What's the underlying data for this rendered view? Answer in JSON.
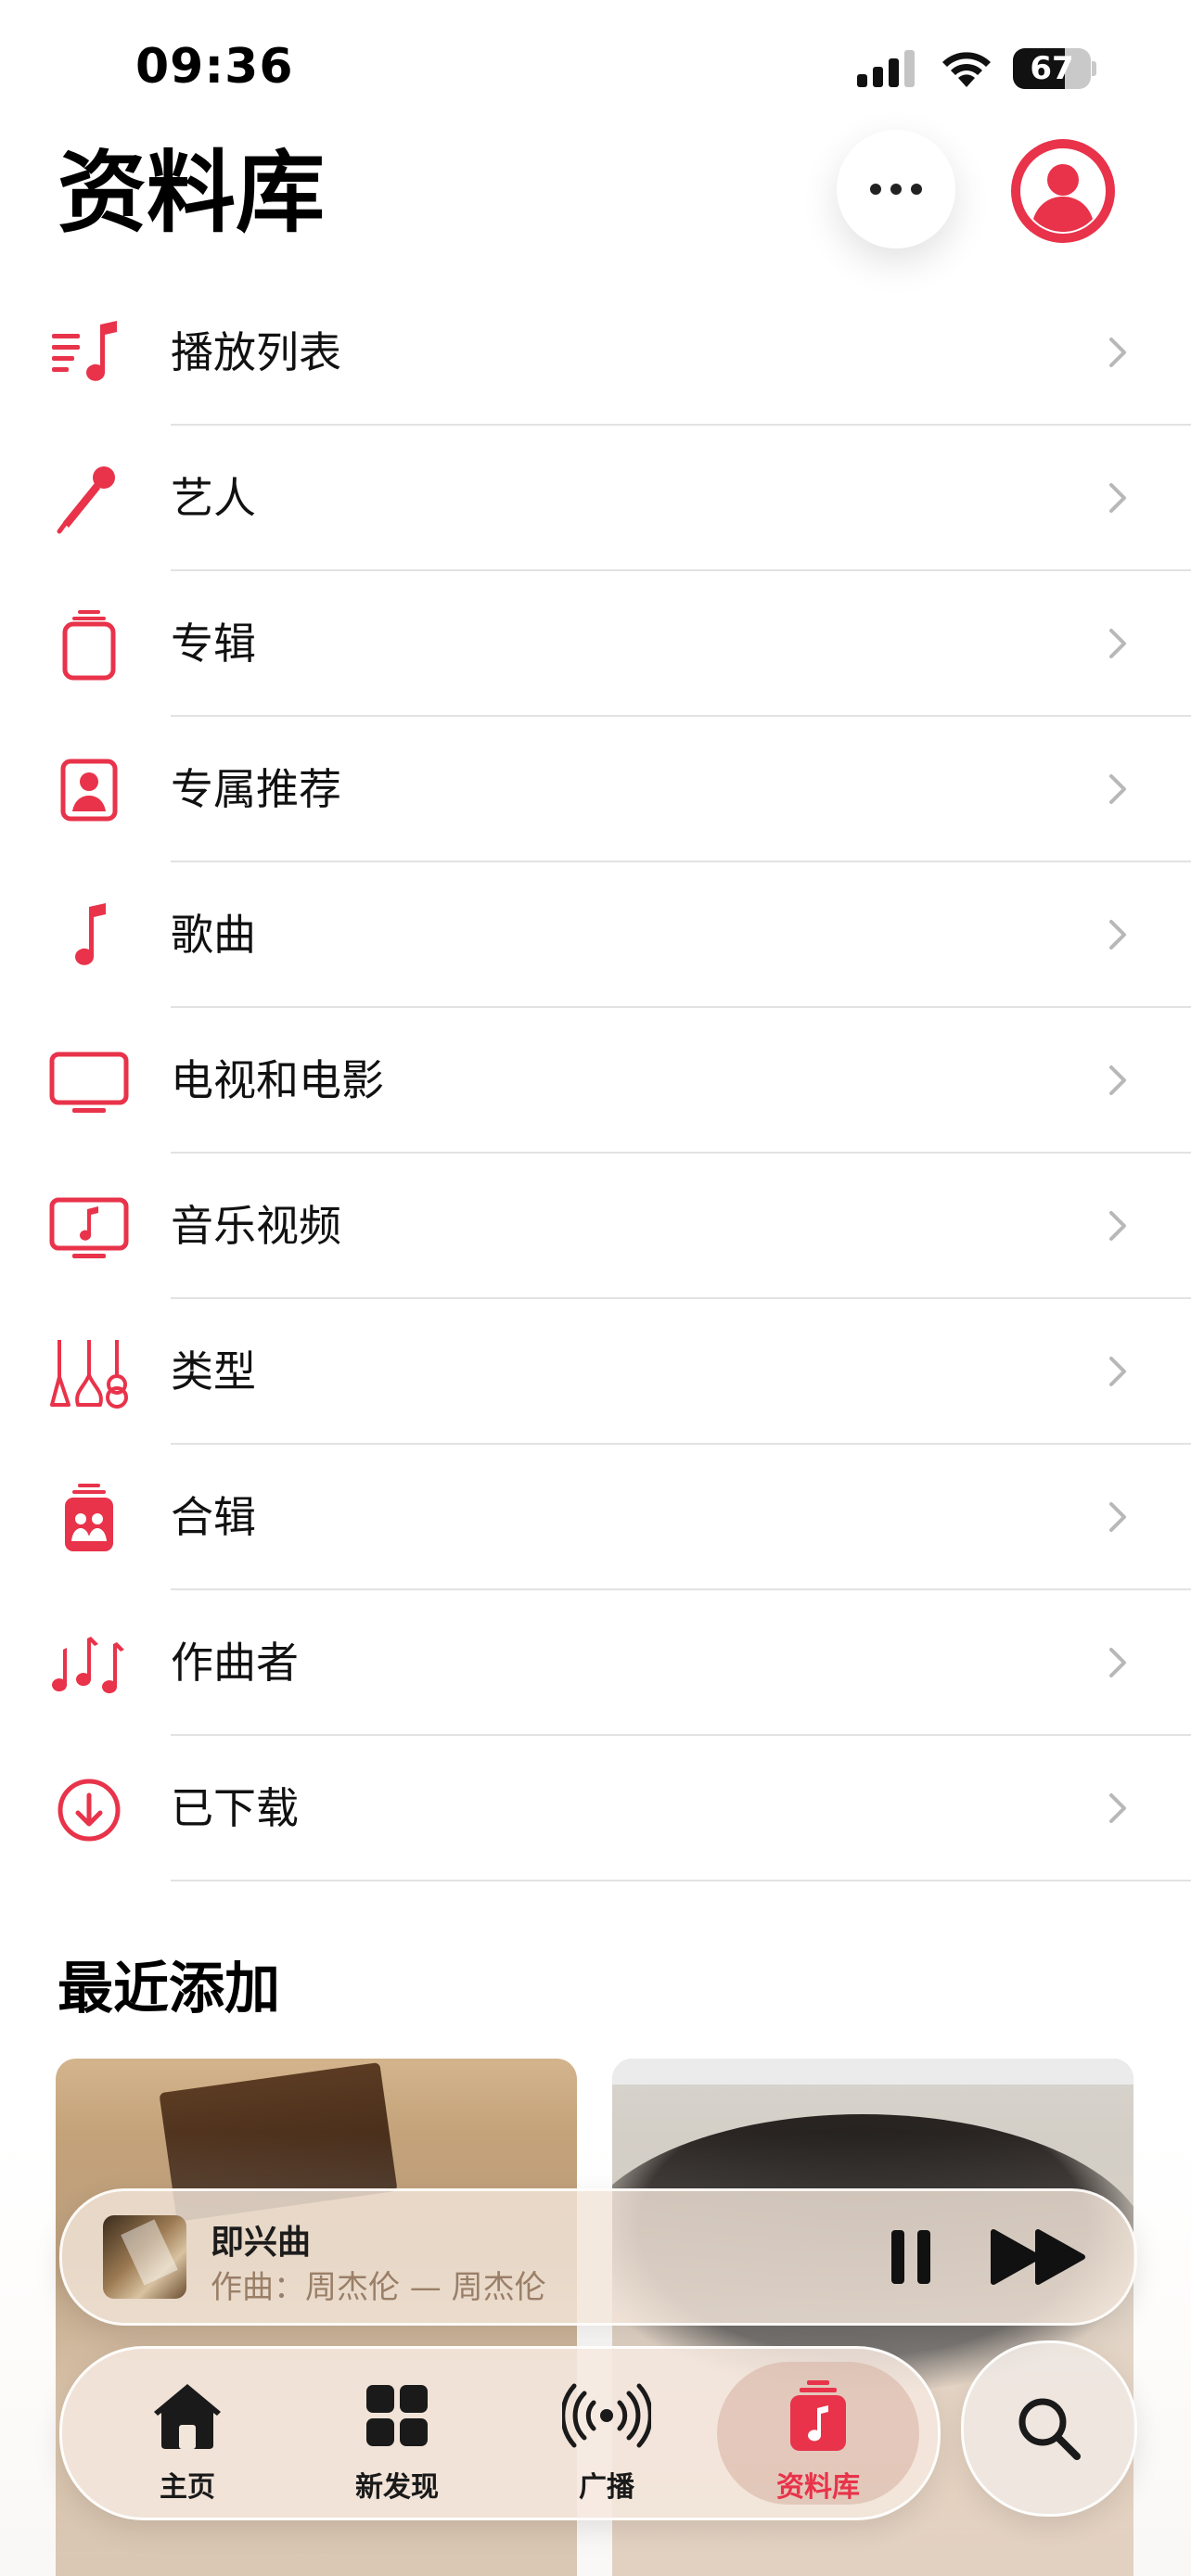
{
  "status_bar": {
    "time": "09:36",
    "battery": "67",
    "battery_level_percent": 67
  },
  "header": {
    "title": "资料库"
  },
  "library_items": [
    {
      "label": "播放列表",
      "icon": "playlist-icon"
    },
    {
      "label": "艺人",
      "icon": "microphone-icon"
    },
    {
      "label": "专辑",
      "icon": "album-stack-icon"
    },
    {
      "label": "专属推荐",
      "icon": "person-square-icon"
    },
    {
      "label": "歌曲",
      "icon": "music-note-icon"
    },
    {
      "label": "电视和电影",
      "icon": "tv-icon"
    },
    {
      "label": "音乐视频",
      "icon": "music-video-icon"
    },
    {
      "label": "类型",
      "icon": "guitars-icon"
    },
    {
      "label": "合辑",
      "icon": "compilation-icon"
    },
    {
      "label": "作曲者",
      "icon": "music-notes-icon"
    },
    {
      "label": "已下载",
      "icon": "download-circle-icon"
    }
  ],
  "recent": {
    "title": "最近添加"
  },
  "now_playing": {
    "title": "即兴曲",
    "subtitle": "作曲：周杰伦 — 周杰伦"
  },
  "tabs": [
    {
      "label": "主页",
      "icon": "home-icon"
    },
    {
      "label": "新发现",
      "icon": "grid-icon"
    },
    {
      "label": "广播",
      "icon": "broadcast-icon"
    },
    {
      "label": "资料库",
      "icon": "library-icon",
      "active": true
    }
  ],
  "colors": {
    "accent": "#e8334a",
    "separator": "#e2e2e2",
    "chevron": "#b8b8b8"
  }
}
